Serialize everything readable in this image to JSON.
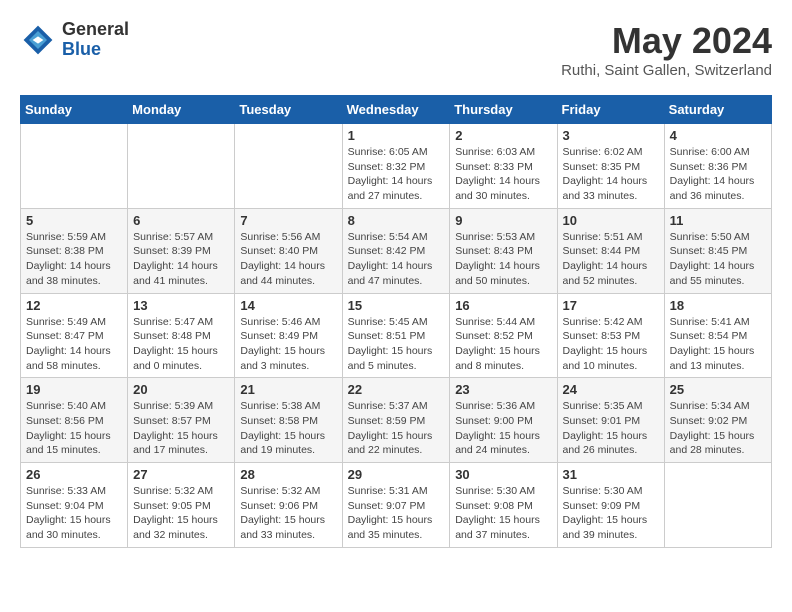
{
  "logo": {
    "general": "General",
    "blue": "Blue"
  },
  "title": {
    "month_year": "May 2024",
    "location": "Ruthi, Saint Gallen, Switzerland"
  },
  "headers": [
    "Sunday",
    "Monday",
    "Tuesday",
    "Wednesday",
    "Thursday",
    "Friday",
    "Saturday"
  ],
  "weeks": [
    [
      {
        "day": "",
        "sunrise": "",
        "sunset": "",
        "daylight": ""
      },
      {
        "day": "",
        "sunrise": "",
        "sunset": "",
        "daylight": ""
      },
      {
        "day": "",
        "sunrise": "",
        "sunset": "",
        "daylight": ""
      },
      {
        "day": "1",
        "sunrise": "Sunrise: 6:05 AM",
        "sunset": "Sunset: 8:32 PM",
        "daylight": "Daylight: 14 hours and 27 minutes."
      },
      {
        "day": "2",
        "sunrise": "Sunrise: 6:03 AM",
        "sunset": "Sunset: 8:33 PM",
        "daylight": "Daylight: 14 hours and 30 minutes."
      },
      {
        "day": "3",
        "sunrise": "Sunrise: 6:02 AM",
        "sunset": "Sunset: 8:35 PM",
        "daylight": "Daylight: 14 hours and 33 minutes."
      },
      {
        "day": "4",
        "sunrise": "Sunrise: 6:00 AM",
        "sunset": "Sunset: 8:36 PM",
        "daylight": "Daylight: 14 hours and 36 minutes."
      }
    ],
    [
      {
        "day": "5",
        "sunrise": "Sunrise: 5:59 AM",
        "sunset": "Sunset: 8:38 PM",
        "daylight": "Daylight: 14 hours and 38 minutes."
      },
      {
        "day": "6",
        "sunrise": "Sunrise: 5:57 AM",
        "sunset": "Sunset: 8:39 PM",
        "daylight": "Daylight: 14 hours and 41 minutes."
      },
      {
        "day": "7",
        "sunrise": "Sunrise: 5:56 AM",
        "sunset": "Sunset: 8:40 PM",
        "daylight": "Daylight: 14 hours and 44 minutes."
      },
      {
        "day": "8",
        "sunrise": "Sunrise: 5:54 AM",
        "sunset": "Sunset: 8:42 PM",
        "daylight": "Daylight: 14 hours and 47 minutes."
      },
      {
        "day": "9",
        "sunrise": "Sunrise: 5:53 AM",
        "sunset": "Sunset: 8:43 PM",
        "daylight": "Daylight: 14 hours and 50 minutes."
      },
      {
        "day": "10",
        "sunrise": "Sunrise: 5:51 AM",
        "sunset": "Sunset: 8:44 PM",
        "daylight": "Daylight: 14 hours and 52 minutes."
      },
      {
        "day": "11",
        "sunrise": "Sunrise: 5:50 AM",
        "sunset": "Sunset: 8:45 PM",
        "daylight": "Daylight: 14 hours and 55 minutes."
      }
    ],
    [
      {
        "day": "12",
        "sunrise": "Sunrise: 5:49 AM",
        "sunset": "Sunset: 8:47 PM",
        "daylight": "Daylight: 14 hours and 58 minutes."
      },
      {
        "day": "13",
        "sunrise": "Sunrise: 5:47 AM",
        "sunset": "Sunset: 8:48 PM",
        "daylight": "Daylight: 15 hours and 0 minutes."
      },
      {
        "day": "14",
        "sunrise": "Sunrise: 5:46 AM",
        "sunset": "Sunset: 8:49 PM",
        "daylight": "Daylight: 15 hours and 3 minutes."
      },
      {
        "day": "15",
        "sunrise": "Sunrise: 5:45 AM",
        "sunset": "Sunset: 8:51 PM",
        "daylight": "Daylight: 15 hours and 5 minutes."
      },
      {
        "day": "16",
        "sunrise": "Sunrise: 5:44 AM",
        "sunset": "Sunset: 8:52 PM",
        "daylight": "Daylight: 15 hours and 8 minutes."
      },
      {
        "day": "17",
        "sunrise": "Sunrise: 5:42 AM",
        "sunset": "Sunset: 8:53 PM",
        "daylight": "Daylight: 15 hours and 10 minutes."
      },
      {
        "day": "18",
        "sunrise": "Sunrise: 5:41 AM",
        "sunset": "Sunset: 8:54 PM",
        "daylight": "Daylight: 15 hours and 13 minutes."
      }
    ],
    [
      {
        "day": "19",
        "sunrise": "Sunrise: 5:40 AM",
        "sunset": "Sunset: 8:56 PM",
        "daylight": "Daylight: 15 hours and 15 minutes."
      },
      {
        "day": "20",
        "sunrise": "Sunrise: 5:39 AM",
        "sunset": "Sunset: 8:57 PM",
        "daylight": "Daylight: 15 hours and 17 minutes."
      },
      {
        "day": "21",
        "sunrise": "Sunrise: 5:38 AM",
        "sunset": "Sunset: 8:58 PM",
        "daylight": "Daylight: 15 hours and 19 minutes."
      },
      {
        "day": "22",
        "sunrise": "Sunrise: 5:37 AM",
        "sunset": "Sunset: 8:59 PM",
        "daylight": "Daylight: 15 hours and 22 minutes."
      },
      {
        "day": "23",
        "sunrise": "Sunrise: 5:36 AM",
        "sunset": "Sunset: 9:00 PM",
        "daylight": "Daylight: 15 hours and 24 minutes."
      },
      {
        "day": "24",
        "sunrise": "Sunrise: 5:35 AM",
        "sunset": "Sunset: 9:01 PM",
        "daylight": "Daylight: 15 hours and 26 minutes."
      },
      {
        "day": "25",
        "sunrise": "Sunrise: 5:34 AM",
        "sunset": "Sunset: 9:02 PM",
        "daylight": "Daylight: 15 hours and 28 minutes."
      }
    ],
    [
      {
        "day": "26",
        "sunrise": "Sunrise: 5:33 AM",
        "sunset": "Sunset: 9:04 PM",
        "daylight": "Daylight: 15 hours and 30 minutes."
      },
      {
        "day": "27",
        "sunrise": "Sunrise: 5:32 AM",
        "sunset": "Sunset: 9:05 PM",
        "daylight": "Daylight: 15 hours and 32 minutes."
      },
      {
        "day": "28",
        "sunrise": "Sunrise: 5:32 AM",
        "sunset": "Sunset: 9:06 PM",
        "daylight": "Daylight: 15 hours and 33 minutes."
      },
      {
        "day": "29",
        "sunrise": "Sunrise: 5:31 AM",
        "sunset": "Sunset: 9:07 PM",
        "daylight": "Daylight: 15 hours and 35 minutes."
      },
      {
        "day": "30",
        "sunrise": "Sunrise: 5:30 AM",
        "sunset": "Sunset: 9:08 PM",
        "daylight": "Daylight: 15 hours and 37 minutes."
      },
      {
        "day": "31",
        "sunrise": "Sunrise: 5:30 AM",
        "sunset": "Sunset: 9:09 PM",
        "daylight": "Daylight: 15 hours and 39 minutes."
      },
      {
        "day": "",
        "sunrise": "",
        "sunset": "",
        "daylight": ""
      }
    ]
  ]
}
